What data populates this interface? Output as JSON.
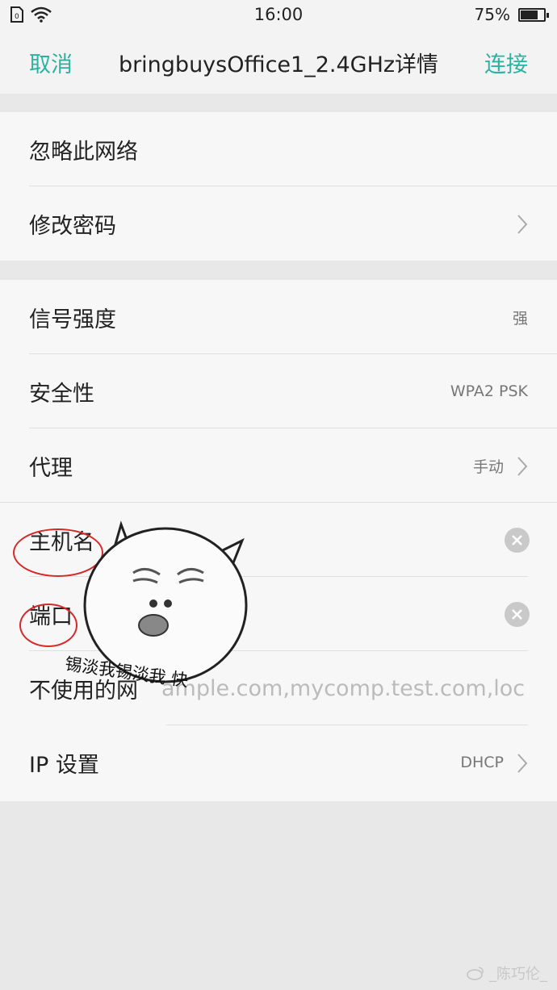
{
  "status_bar": {
    "time": "16:00",
    "battery_percent": "75%",
    "battery_level": 0.75
  },
  "nav": {
    "cancel": "取消",
    "title": "bringbuysOffice1_2.4GHz详情",
    "connect": "连接"
  },
  "group1": {
    "forget_network": "忽略此网络",
    "change_password": "修改密码"
  },
  "group2": {
    "signal_label": "信号强度",
    "signal_value": "强",
    "security_label": "安全性",
    "security_value": "WPA2 PSK",
    "proxy_label": "代理",
    "proxy_value": "手动",
    "hostname_label": "主机名",
    "port_label": "端口",
    "bypass_label": "不使用的网",
    "bypass_value": "ample.com,mycomp.test.com,loc",
    "ip_label": "IP 设置",
    "ip_value": "DHCP"
  },
  "sticker": {
    "caption": "锡淡我锡淡我 快"
  },
  "watermark": {
    "text": "_陈巧伦_"
  },
  "colors": {
    "accent": "#2bb3a0",
    "annotation_red": "#d62a2a"
  }
}
